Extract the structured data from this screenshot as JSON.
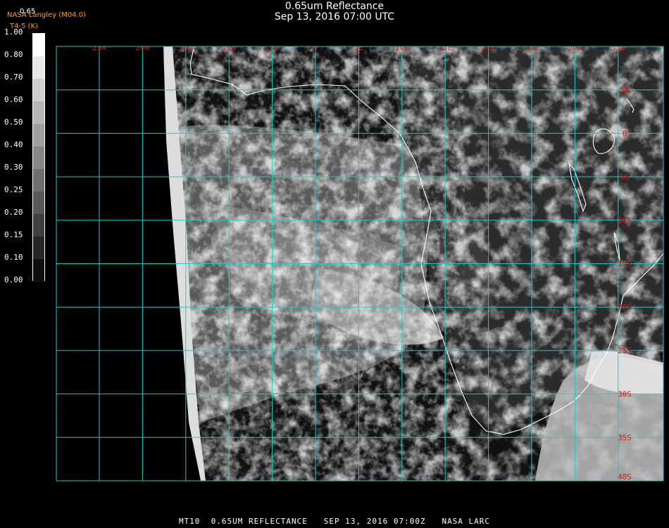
{
  "header": {
    "title": "0.65um Reflectance",
    "datetime": "Sep 13, 2016 07:00 UTC",
    "brand": "NASA Langley (M04.0)",
    "brand_sub": "T4-5 (K)",
    "band_label": "0.65"
  },
  "colorbar": {
    "ticks": [
      "1.00",
      "0.80",
      "0.70",
      "0.60",
      "0.50",
      "0.40",
      "0.30",
      "0.25",
      "0.20",
      "0.15",
      "0.10",
      "0.00"
    ]
  },
  "map": {
    "lon_labels": [
      "25W",
      "20W",
      "15W",
      "10W",
      "5W",
      "0",
      "5E",
      "10E",
      "15E",
      "20E",
      "25E",
      "30E",
      "35E"
    ],
    "lat_labels": [
      "5N",
      "0",
      "5S",
      "10S",
      "15S",
      "20S",
      "25S",
      "30S",
      "35S",
      "40S"
    ],
    "grid_color": "#26c6c6",
    "label_color": "#d21a1a",
    "coast_color": "#ffffff"
  },
  "footer": "MT10  0.65UM REFLECTANCE   SEP 13, 2016 07:00Z   NASA LARC"
}
